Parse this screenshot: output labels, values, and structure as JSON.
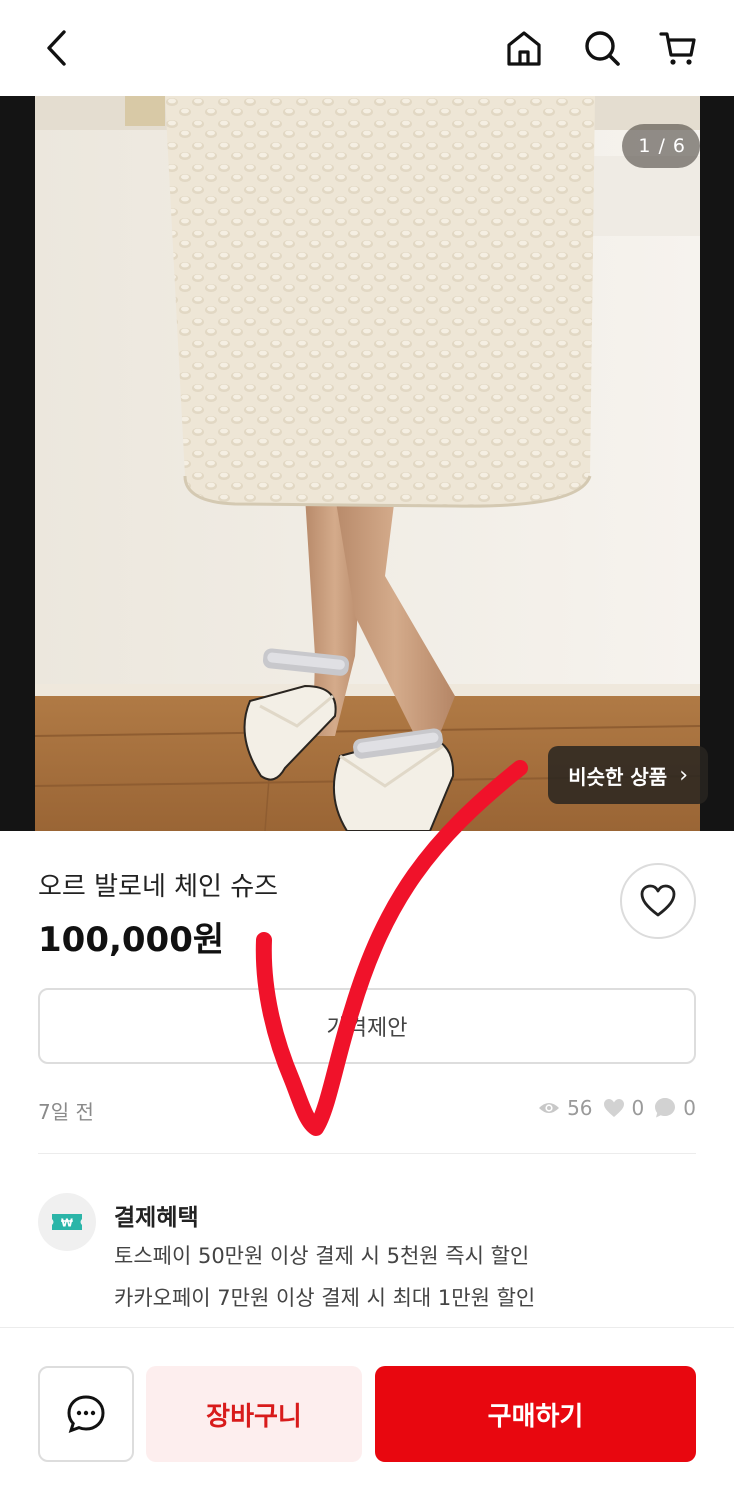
{
  "header": {
    "back_icon": "chevron-left-icon",
    "home_icon": "home-icon",
    "search_icon": "search-icon",
    "cart_icon": "cart-icon"
  },
  "gallery": {
    "counter": "1 / 6",
    "similar_label": "비슷한 상품",
    "similar_chevron": "›"
  },
  "product": {
    "title": "오르 발로네 체인 슈즈",
    "price": "100,000원",
    "offer_label": "가격제안",
    "posted": "7일 전",
    "views": "56",
    "likes": "0",
    "chats": "0"
  },
  "benefit": {
    "title": "결제혜택",
    "lines": [
      "토스페이 50만원 이상 결제 시 5천원 즉시 할인",
      "카카오페이 7만원 이상 결제 시 최대 1만원 할인"
    ],
    "icon_glyph": "₩"
  },
  "actions": {
    "cart_label": "장바구니",
    "buy_label": "구매하기"
  },
  "colors": {
    "accent": "#e8070f",
    "cart_bg": "#fdeeee",
    "cart_text": "#d81b1b",
    "benefit_icon": "#2bb5a8"
  }
}
